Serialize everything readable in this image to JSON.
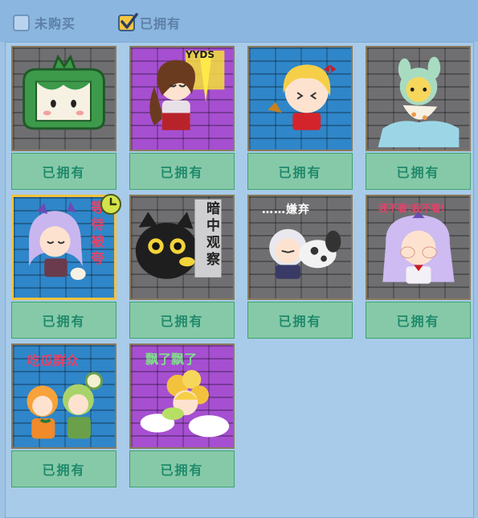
{
  "filters": {
    "unowned_label": "未购买",
    "owned_label": "已拥有",
    "unowned_checked": false,
    "owned_checked": true
  },
  "stickers": [
    {
      "bg": "gray",
      "button_label": "已拥有"
    },
    {
      "bg": "purple",
      "button_label": "已拥有",
      "caption": "YYDS"
    },
    {
      "bg": "blue",
      "button_label": "已拥有"
    },
    {
      "bg": "gray",
      "button_label": "已拥有"
    },
    {
      "bg": "blue",
      "button_label": "已拥有",
      "caption": "等待被夸",
      "selected": true,
      "badge": "clock-icon"
    },
    {
      "bg": "gray",
      "button_label": "已拥有",
      "caption": "暗中观察"
    },
    {
      "bg": "gray",
      "button_label": "已拥有",
      "caption": "……嫌弃"
    },
    {
      "bg": "gray",
      "button_label": "已拥有",
      "caption": "我不看!我不看!"
    },
    {
      "bg": "blue",
      "button_label": "已拥有",
      "caption": "吃瓜群众"
    },
    {
      "bg": "purple",
      "button_label": "已拥有",
      "caption": "飘了飘了"
    }
  ],
  "colors": {
    "background": "#9ec3e4",
    "owned_button_bg": "#86c9a8",
    "owned_button_text": "#1f8a6b",
    "selected_border": "#f3c23d",
    "checkbox_checked": "#f5c542"
  }
}
